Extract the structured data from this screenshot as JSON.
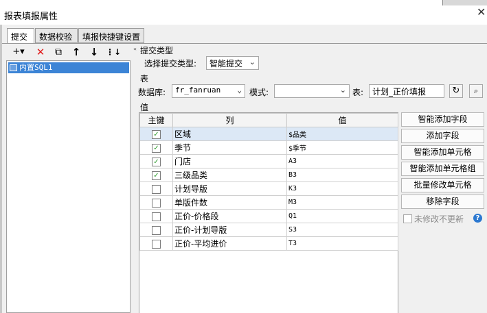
{
  "window": {
    "title": "报表填报属性",
    "close_glyph": "✕"
  },
  "tabs": [
    {
      "label": "提交"
    },
    {
      "label": "数据校验"
    },
    {
      "label": "填报快捷键设置"
    }
  ],
  "left_toolbar": {
    "add": "+▾",
    "delete": "✕",
    "copy": "⧉",
    "up": "↑",
    "down": "↓",
    "more": "⋮↓",
    "collapse": "«"
  },
  "tree": {
    "items": [
      {
        "label": "内置SQL1"
      }
    ]
  },
  "submit_type": {
    "section": "提交类型",
    "label": "选择提交类型:",
    "value": "智能提交"
  },
  "table_section": {
    "section": "表",
    "db_label": "数据库:",
    "db_value": "fr_fanruan",
    "schema_label": "模式:",
    "schema_value": "",
    "table_label": "表:",
    "table_value": "计划_正价填报"
  },
  "value_section": {
    "section": "值"
  },
  "grid": {
    "headers": [
      "主键",
      "列",
      "值"
    ],
    "rows": [
      {
        "checked": true,
        "column": "区域",
        "value": "$品类",
        "selected": true
      },
      {
        "checked": true,
        "column": "季节",
        "value": "$季节"
      },
      {
        "checked": true,
        "column": "门店",
        "value": "A3"
      },
      {
        "checked": true,
        "column": "三级品类",
        "value": "B3"
      },
      {
        "checked": false,
        "column": "计划导版",
        "value": "K3"
      },
      {
        "checked": false,
        "column": "单版件数",
        "value": "M3"
      },
      {
        "checked": false,
        "column": "正价-价格段",
        "value": "Q1"
      },
      {
        "checked": false,
        "column": "正价-计划导版",
        "value": "S3"
      },
      {
        "checked": false,
        "column": "正价-平均进价",
        "value": "T3"
      }
    ]
  },
  "right_buttons": [
    "智能添加字段",
    "添加字段",
    "智能添加单元格",
    "智能添加单元格组",
    "批量修改单元格",
    "移除字段"
  ],
  "unmodified": {
    "label": "未修改不更新",
    "checked": false,
    "help": "?"
  },
  "colors": {
    "selection": "#3c84d6",
    "check": "#2a9a2a",
    "help": "#2b78d0"
  }
}
